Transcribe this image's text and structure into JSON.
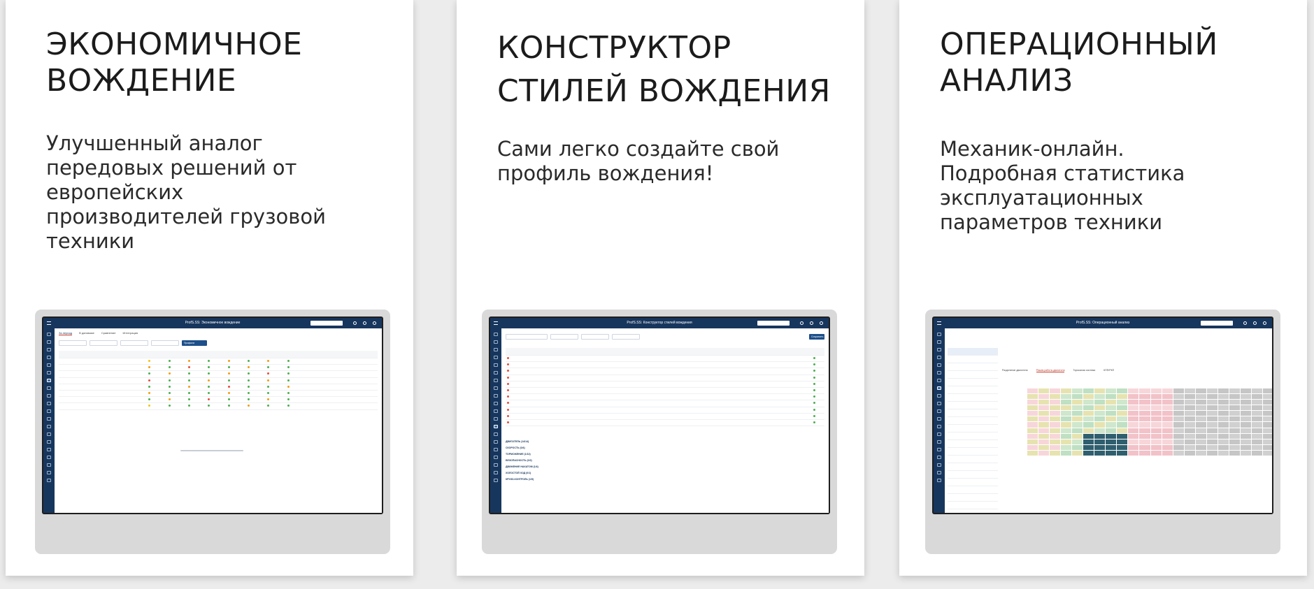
{
  "cards": [
    {
      "title": "ЭКОНОМИЧНОЕ\nВОЖДЕНИЕ",
      "description": "Улучшенный аналог\nпередовых решений от\nевропейских\nпроизводителей грузовой\nтехники",
      "screen": {
        "app_title": "ProfS.SS: Экономичное вождение",
        "tabs": [
          "За период",
          "В динамике",
          "Сравнение",
          "Интеграция"
        ],
        "action_button": "Профили вождения"
      }
    },
    {
      "title": "КОНСТРУКТОР\nСТИЛЕЙ ВОЖДЕНИЯ",
      "description": "Сами легко создайте свой\nпрофиль вождения!",
      "screen": {
        "app_title": "ProfS.SS: Конструктор стилей вождения",
        "action_button": "Сохранить",
        "sections": [
          "ДВИГАТЕЛЬ (14/14)",
          "СКОРОСТЬ (0/4)",
          "ТОРМОЖЕНИЕ (1/13)",
          "БЕЗОПАСНОСТЬ (0/2)",
          "ДВИЖЕНИЕ НАКАТОМ (1/4)",
          "ХОЛОСТОЙ ХОД (0/1)",
          "КРУИЗ-КОНТРОЛЬ (1/5)"
        ]
      }
    },
    {
      "title": "ОПЕРАЦИОННЫЙ\nАНАЛИЗ",
      "description": "Механик-онлайн.\nПодробная статистика\nэксплуатационных\nпараметров техники",
      "screen": {
        "app_title": "ProfS.SS: Операционный анализ",
        "subtabs": [
          "Разделение двигателя",
          "Режим работы двигателя",
          "Тормозная система",
          "КПП/РКП"
        ]
      }
    }
  ]
}
